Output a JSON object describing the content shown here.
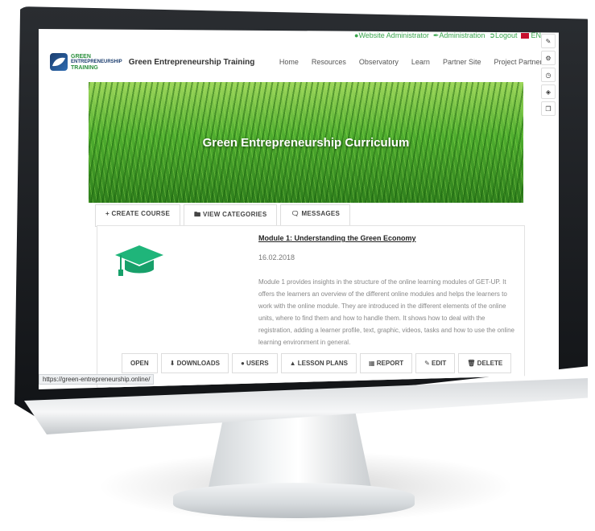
{
  "topbar": {
    "website_admin": "Website Administrator",
    "administration": "Administration",
    "logout": "Logout",
    "language": "EN"
  },
  "header": {
    "logo_line1": "GREEN",
    "logo_line2": "ENTREPRENEURSHIP",
    "logo_line3": "TRAINING",
    "brand": "Green Entrepreneurship Training",
    "nav": [
      "Home",
      "Resources",
      "Observatory",
      "Learn",
      "Partner Site",
      "Project Partners"
    ]
  },
  "hero": {
    "title": "Green Entrepreneurship Curriculum"
  },
  "tabs": {
    "create": "+ CREATE COURSE",
    "categories": "VIEW CATEGORIES",
    "messages": "MESSAGES"
  },
  "course": {
    "title": "Module 1: Understanding the Green Economy",
    "date": "16.02.2018",
    "description": "Module 1 provides insights in the structure of the online learning modules of GET-UP. It offers the learners an overview of the different online modules and helps the learners to work with the online module. They are introduced in the different elements of the online units, where to find them and how to handle them. It shows how to deal with the registration, adding a learner profile, text, graphic, videos, tasks and how to use the online learning environment in general."
  },
  "actions": {
    "open": "OPEN",
    "downloads": "DOWNLOADS",
    "users": "USERS",
    "lesson_plans": "LESSON PLANS",
    "report": "REPORT",
    "edit": "EDIT",
    "delete": "DELETE"
  },
  "statusbar": {
    "url": "https://green-entrepreneurship.online/"
  },
  "colors": {
    "accent_green": "#3aa64e",
    "cap_green": "#1fb57a",
    "brand_blue": "#1b3d6e"
  }
}
